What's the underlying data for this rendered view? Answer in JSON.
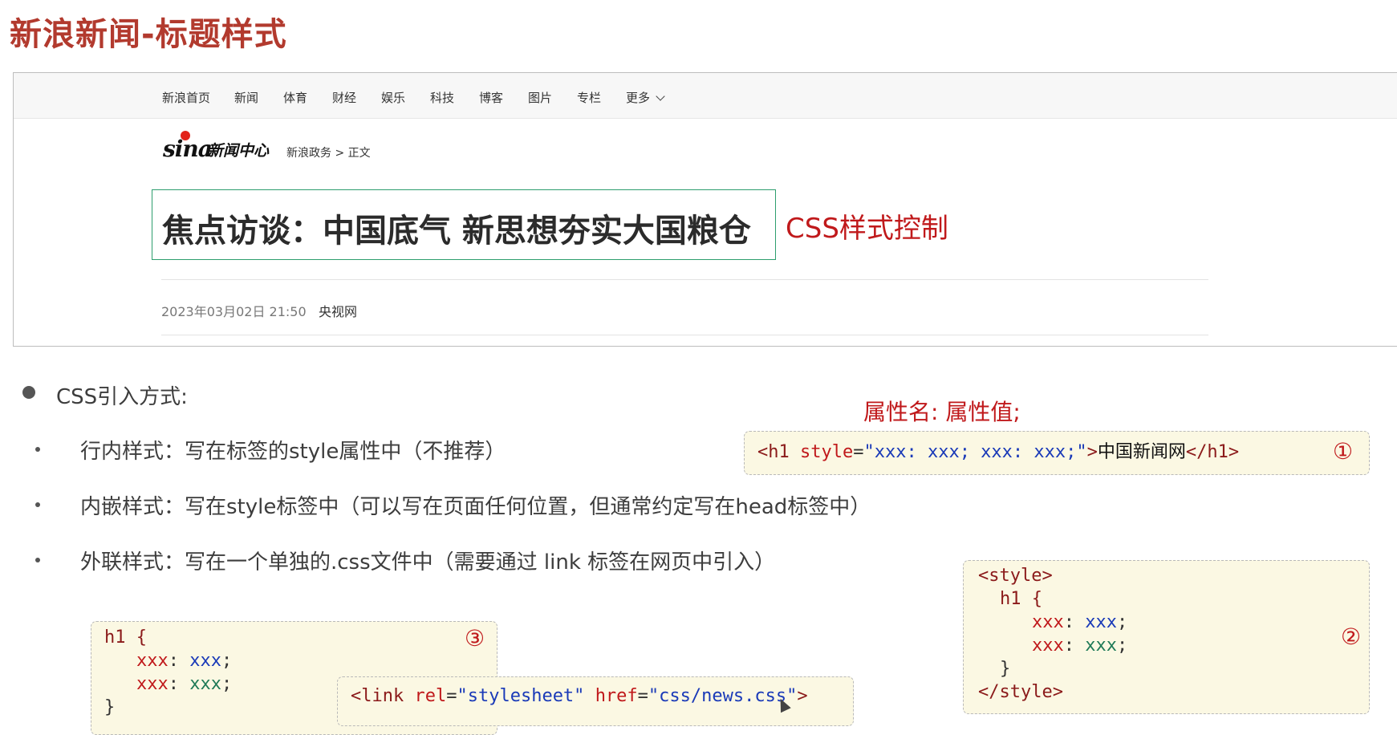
{
  "slide": {
    "title": "新浪新闻-标题样式"
  },
  "nav": {
    "items": [
      "新浪首页",
      "新闻",
      "体育",
      "财经",
      "娱乐",
      "科技",
      "博客",
      "图片",
      "专栏",
      "更多"
    ]
  },
  "site": {
    "logo_text": "sina",
    "center_name": "新闻中心",
    "breadcrumb": "新浪政务 > 正文"
  },
  "article": {
    "headline": "焦点访谈：中国底气 新思想夯实大国粮仓",
    "date": "2023年03月02日 21:50",
    "source": "央视网"
  },
  "annotation": {
    "css_control": "CSS样式控制",
    "attr_syntax": "属性名: 属性值;"
  },
  "bullets": {
    "heading": "CSS引入方式:",
    "items": [
      "行内样式：写在标签的style属性中（不推荐）",
      "内嵌样式：写在style标签中（可以写在页面任何位置，但通常约定写在head标签中）",
      "外联样式：写在一个单独的.css文件中（需要通过 link 标签在网页中引入）"
    ]
  },
  "code": {
    "inline": {
      "open_tag": "<h1",
      "attr": "style",
      "eq": "=",
      "value": "\"xxx: xxx; xxx: xxx;\"",
      "close_open": ">",
      "text": "中国新闻网",
      "close_tag": "</h1>",
      "badge": "①"
    },
    "embedded": {
      "style_open": "<style>",
      "selector": "h1 {",
      "prop": "xxx",
      "colon": ": ",
      "val1": "xxx",
      "val2": "xxx",
      "semi": ";",
      "brace_close": "}",
      "style_close": "</style>",
      "badge": "②"
    },
    "external": {
      "selector": "h1 {",
      "prop": "xxx",
      "colon": ": ",
      "val1": "xxx",
      "val2": "xxx",
      "semi": ";",
      "brace_close": "}",
      "badge": "③"
    },
    "link": {
      "open": "<link",
      "rel_attr": "rel",
      "rel_val": "\"stylesheet\"",
      "href_attr": "href",
      "href_val": "\"css/news.css\"",
      "eq": "=",
      "close": ">"
    }
  },
  "colors": {
    "title_red": "#b23a2e",
    "note_red": "#c0191b",
    "headline_border": "#2e9e6e",
    "code_bg": "#fbf8e3"
  }
}
